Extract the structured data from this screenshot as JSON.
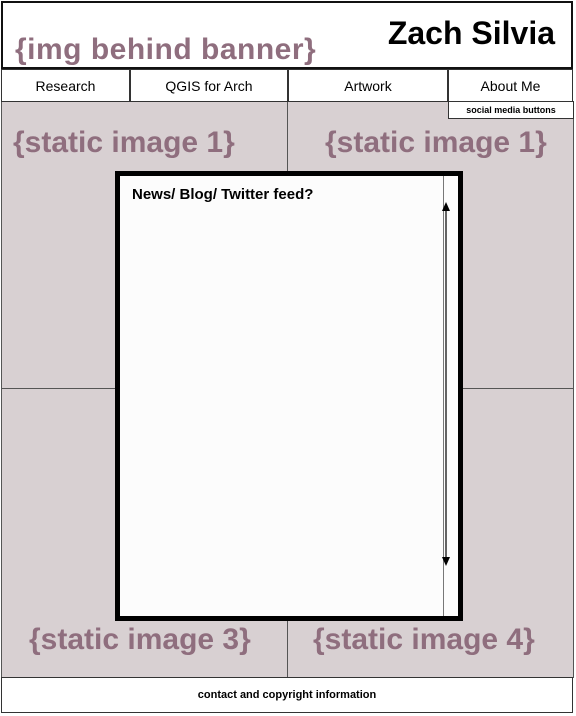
{
  "header": {
    "banner_placeholder": "{img behind banner}",
    "site_title": "Zach Silvia"
  },
  "nav": {
    "items": [
      {
        "label": "Research"
      },
      {
        "label": "QGIS for Arch"
      },
      {
        "label": "Artwork"
      },
      {
        "label": "About Me"
      }
    ]
  },
  "social": {
    "label": "social media buttons"
  },
  "images": {
    "top_left": "{static image 1}",
    "top_right": "{static image 1}",
    "bottom_left": "{static image 3}",
    "bottom_right": "{static image 4}"
  },
  "feed": {
    "title": "News/ Blog/ Twitter feed?"
  },
  "footer": {
    "label": "contact and copyright information"
  },
  "colors": {
    "placeholder_text": "#8f6e7e",
    "image_fill": "#d8d0d2"
  }
}
